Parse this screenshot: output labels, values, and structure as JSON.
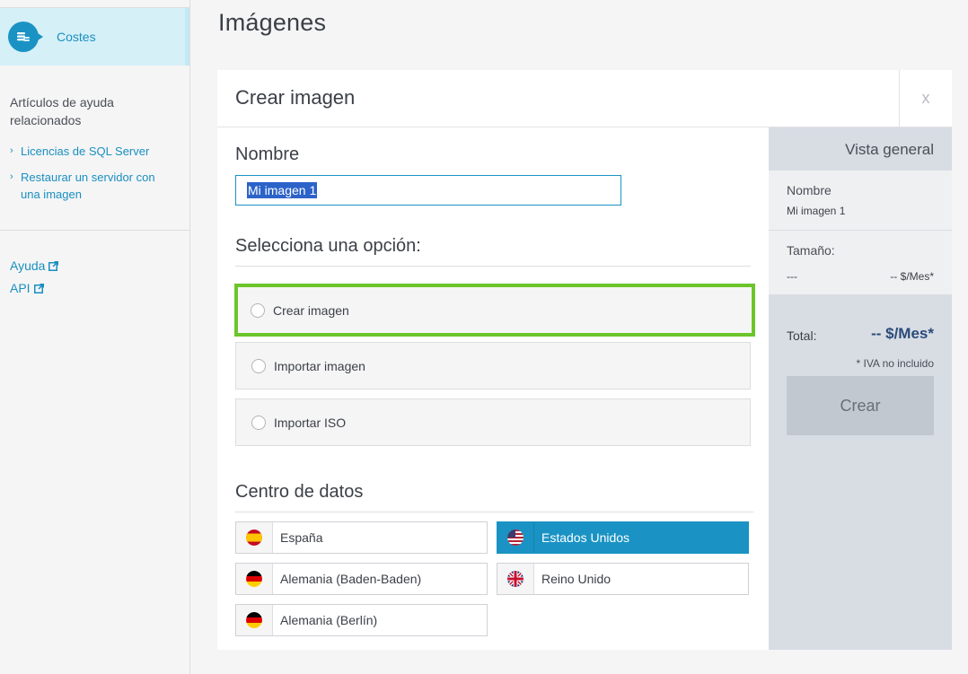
{
  "sidebar": {
    "active_item": {
      "label": "Costes",
      "icon": "coins-icon"
    },
    "help_title": "Artículos de ayuda relacionados",
    "help_links": [
      {
        "label": "Licencias de SQL Server"
      },
      {
        "label": "Restaurar un servidor con una imagen"
      }
    ],
    "external_links": [
      {
        "label": "Ayuda"
      },
      {
        "label": "API"
      }
    ]
  },
  "page": {
    "title": "Imágenes"
  },
  "panel": {
    "title": "Crear imagen",
    "close_label": "x",
    "name_label": "Nombre",
    "name_value": "Mi imagen 1",
    "option_label": "Selecciona una opción:",
    "options": [
      {
        "label": "Crear imagen",
        "highlighted": true
      },
      {
        "label": "Importar imagen",
        "highlighted": false
      },
      {
        "label": "Importar ISO",
        "highlighted": false
      }
    ],
    "datacenter_label": "Centro de datos",
    "datacenters": [
      {
        "label": "España",
        "flag": "spain-flag-icon",
        "selected": false
      },
      {
        "label": "Estados Unidos",
        "flag": "usa-flag-icon",
        "selected": true
      },
      {
        "label": "Alemania (Baden-Baden)",
        "flag": "germany-flag-icon",
        "selected": false
      },
      {
        "label": "Reino Unido",
        "flag": "uk-flag-icon",
        "selected": false
      },
      {
        "label": "Alemania (Berlín)",
        "flag": "germany-flag-icon",
        "selected": false
      }
    ]
  },
  "summary": {
    "title": "Vista general",
    "name_label": "Nombre",
    "name_value": "Mi imagen 1",
    "size_label": "Tamaño:",
    "size_value": "---",
    "size_price": "-- $/Mes*",
    "total_label": "Total:",
    "total_value": "-- $/Mes*",
    "vat_note": "* IVA no incluido",
    "create_button": "Crear"
  },
  "colors": {
    "accent": "#1a93c4",
    "highlight_border": "#6cc52a",
    "selected_text_bg": "#2c63c9"
  }
}
